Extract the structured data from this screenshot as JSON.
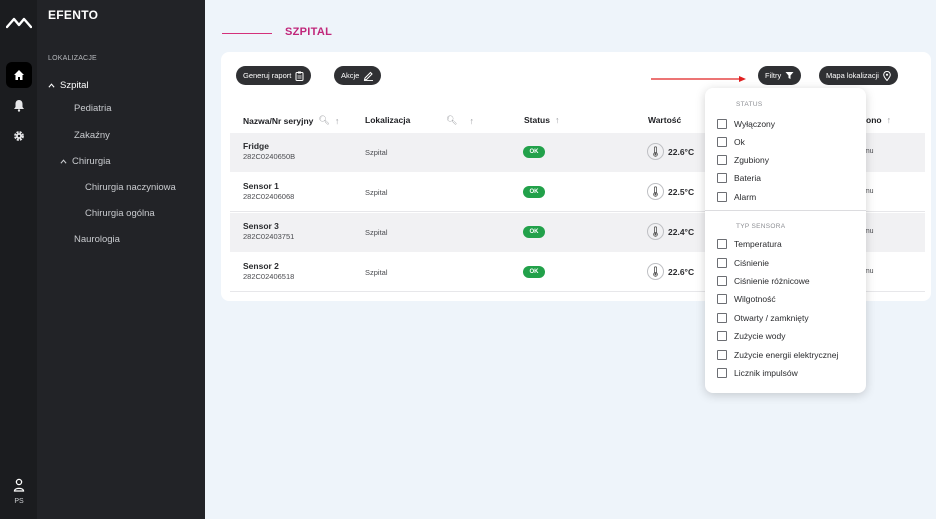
{
  "app": {
    "brand": "EFENTO",
    "user_initials": "PS"
  },
  "sidebar": {
    "section_label": "LOKALIZACJE",
    "root": "Szpital",
    "items": [
      {
        "label": "Pediatria"
      },
      {
        "label": "Zakaźny"
      },
      {
        "label": "Chirurgia"
      },
      {
        "label": "Chirurgia naczyniowa"
      },
      {
        "label": "Chirurgia ogólna"
      },
      {
        "label": "Naurologia"
      }
    ]
  },
  "header": {
    "breadcrumb": "SZPITAL"
  },
  "toolbar": {
    "generate_report": "Generuj raport",
    "actions": "Akcje",
    "filters": "Filtry",
    "location_map": "Mapa lokalizacji"
  },
  "table": {
    "columns": {
      "name": "Nazwa/Nr seryjny",
      "location": "Lokalizacja",
      "status": "Status",
      "value": "Wartość",
      "last_seen_partial": "ono"
    },
    "rows": [
      {
        "name": "Fridge",
        "serial": "282C0240650B",
        "location": "Szpital",
        "status": "OK",
        "value": "22.6°C",
        "ago": "temu"
      },
      {
        "name": "Sensor 1",
        "serial": "282C02406068",
        "location": "Szpital",
        "status": "OK",
        "value": "22.5°C",
        "ago": "temu"
      },
      {
        "name": "Sensor 3",
        "serial": "282C02403751",
        "location": "Szpital",
        "status": "OK",
        "value": "22.4°C",
        "ago": "temu"
      },
      {
        "name": "Sensor 2",
        "serial": "282C02406518",
        "location": "Szpital",
        "status": "OK",
        "value": "22.6°C",
        "ago": "temu"
      }
    ]
  },
  "filters": {
    "status_header": "STATUS",
    "status_options": [
      "Wyłączony",
      "Ok",
      "Zgubiony",
      "Bateria",
      "Alarm"
    ],
    "sensor_type_header": "TYP SENSORA",
    "sensor_type_options": [
      "Temperatura",
      "Ciśnienie",
      "Ciśnienie różnicowe",
      "Wilgotność",
      "Otwarty / zamknięty",
      "Zużycie wody",
      "Zużycie energii elektrycznej",
      "Licznik impulsów"
    ]
  },
  "colors": {
    "accent": "#c0267a",
    "status_ok": "#22a14a",
    "sidebar_bg": "#222327",
    "annotation_arrow": "#e02020"
  }
}
